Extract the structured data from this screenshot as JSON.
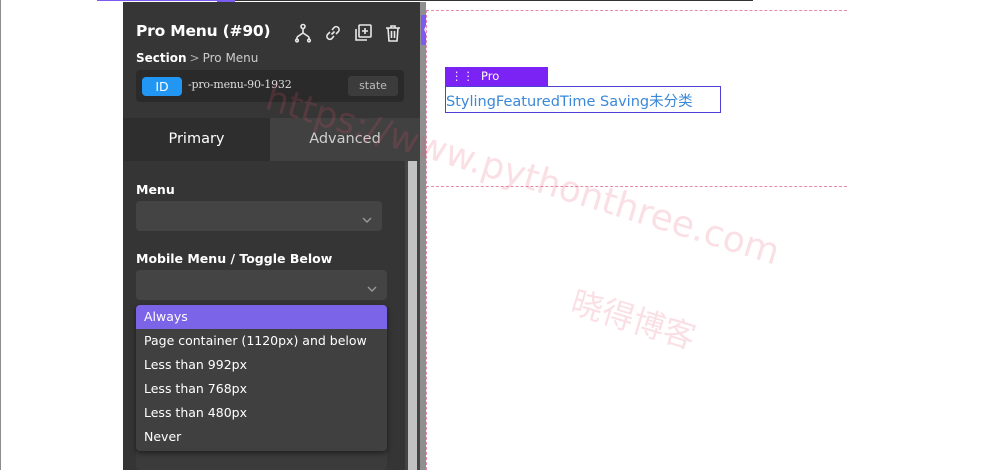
{
  "panel": {
    "title": "Pro Menu (#90)",
    "breadcrumb": {
      "parent": "Section",
      "separator": ">",
      "current": "Pro Menu"
    },
    "id_badge": "ID",
    "id_value": "-pro-menu-90-1932",
    "state_label": "state",
    "tabs": [
      {
        "label": "Primary",
        "active": true
      },
      {
        "label": "Advanced",
        "active": false
      }
    ],
    "fields": {
      "menu_label": "Menu",
      "menu_value": "",
      "mobile_label": "Mobile Menu / Toggle Below",
      "mobile_value": ""
    },
    "dropdown_options": [
      {
        "label": "Always",
        "selected": true
      },
      {
        "label": "Page container (1120px) and below",
        "selected": false
      },
      {
        "label": "Less than 992px",
        "selected": false
      },
      {
        "label": "Less than 768px",
        "selected": false
      },
      {
        "label": "Less than 480px",
        "selected": false
      },
      {
        "label": "Never",
        "selected": false
      }
    ],
    "icons": [
      "structure-icon",
      "link-icon",
      "duplicate-icon",
      "trash-icon"
    ]
  },
  "canvas": {
    "element_tag": "Pro Menu",
    "menu_items_text": "StylingFeaturedTime Saving未分类"
  },
  "watermark": {
    "line1": "https://www.pythonthree.com",
    "line2": "晓得博客"
  },
  "colors": {
    "accent": "#7b22f5",
    "selected_option": "#7c64e8",
    "id_badge": "#2196f3",
    "menu_link": "#3b88d8"
  }
}
